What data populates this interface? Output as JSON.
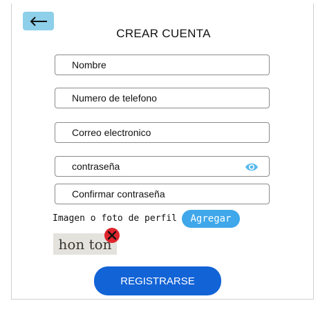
{
  "header": {
    "title": "CREAR CUENTA",
    "back_icon": "arrow-left-icon"
  },
  "form": {
    "fields": [
      {
        "label": "Nombre"
      },
      {
        "label": "Numero de telefono"
      },
      {
        "label": "Correo electronico"
      },
      {
        "label": "contraseña",
        "icon": "eye-icon"
      },
      {
        "label": "Confirmar contraseña"
      }
    ],
    "photo_label": "Imagen o foto de perfil",
    "add_button": "Agregar",
    "photo_thumbnail_text": "hon ton",
    "remove_icon": "close-circle-icon",
    "submit_button": "REGISTRARSE"
  },
  "colors": {
    "back_button": "#8ecfe9",
    "add_button": "#3fa7ea",
    "submit_button": "#1263d6",
    "eye_icon": "#55b8ee",
    "remove_icon": "#e0242c"
  }
}
